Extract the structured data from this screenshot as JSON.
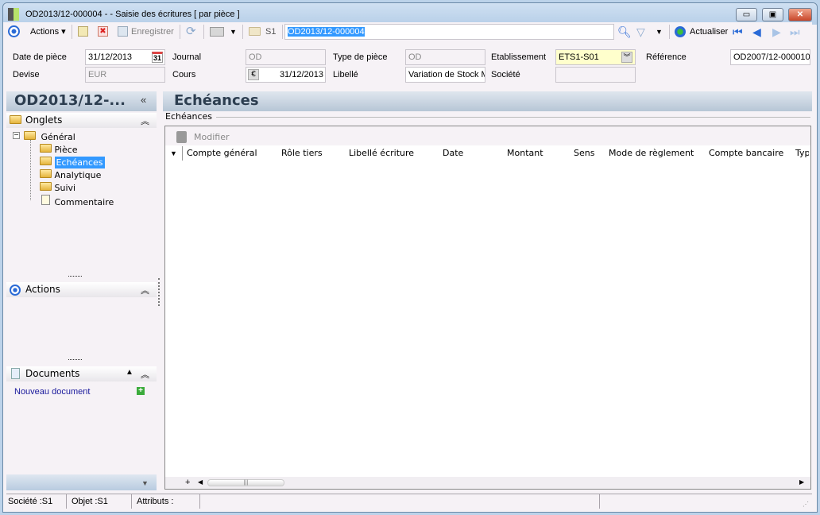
{
  "window": {
    "title": "OD2013/12-000004 -  -  Saisie des écritures [ par pièce ]",
    "minimize": "▭",
    "restore": "▣",
    "close": "✕"
  },
  "toolbar": {
    "actions": "Actions",
    "save": "Enregistrer",
    "s1": "S1",
    "search_value": "OD2013/12-000004",
    "refresh": "Actualiser"
  },
  "form": {
    "date_label": "Date de pièce",
    "date_value": "31/12/2013",
    "calendar_icon": "31",
    "journal_label": "Journal",
    "journal_value": "OD",
    "type_label": "Type de pièce",
    "type_value": "OD",
    "etab_label": "Etablissement",
    "etab_value": "ETS1-S01",
    "ref_label": "Référence",
    "ref_value": "OD2007/12-000010",
    "devise_label": "Devise",
    "devise_value": "EUR",
    "cours_label": "Cours",
    "cours_value": "31/12/2013",
    "libelle_label": "Libellé",
    "libelle_value": "Variation de Stock M",
    "societe_label": "Société",
    "societe_value": ""
  },
  "left_panel": {
    "title": "OD2013/12-...",
    "collapse": "«",
    "onglets": {
      "label": "Onglets",
      "items": [
        {
          "label": "Général"
        },
        {
          "label": "Pièce"
        },
        {
          "label": "Echéances",
          "selected": true
        },
        {
          "label": "Analytique"
        },
        {
          "label": "Suivi"
        },
        {
          "label": "Commentaire"
        }
      ]
    },
    "actions": {
      "label": "Actions"
    },
    "documents": {
      "label": "Documents",
      "new_doc": "Nouveau document"
    }
  },
  "main": {
    "title": "Echéances",
    "group_label": "Echéances",
    "modify": "Modifier",
    "columns": [
      "Compte général",
      "Rôle tiers",
      "Libellé écriture",
      "Date",
      "Montant",
      "Sens",
      "Mode de règlement",
      "Compte bancaire",
      "Typ"
    ]
  },
  "statusbar": {
    "societe": "Société :S1",
    "objet": "Objet :S1",
    "attributs": "Attributs :"
  },
  "colors": {
    "selection": "#3399ff",
    "etab_bg": "#ffffcc",
    "link": "#1a1a9c"
  }
}
